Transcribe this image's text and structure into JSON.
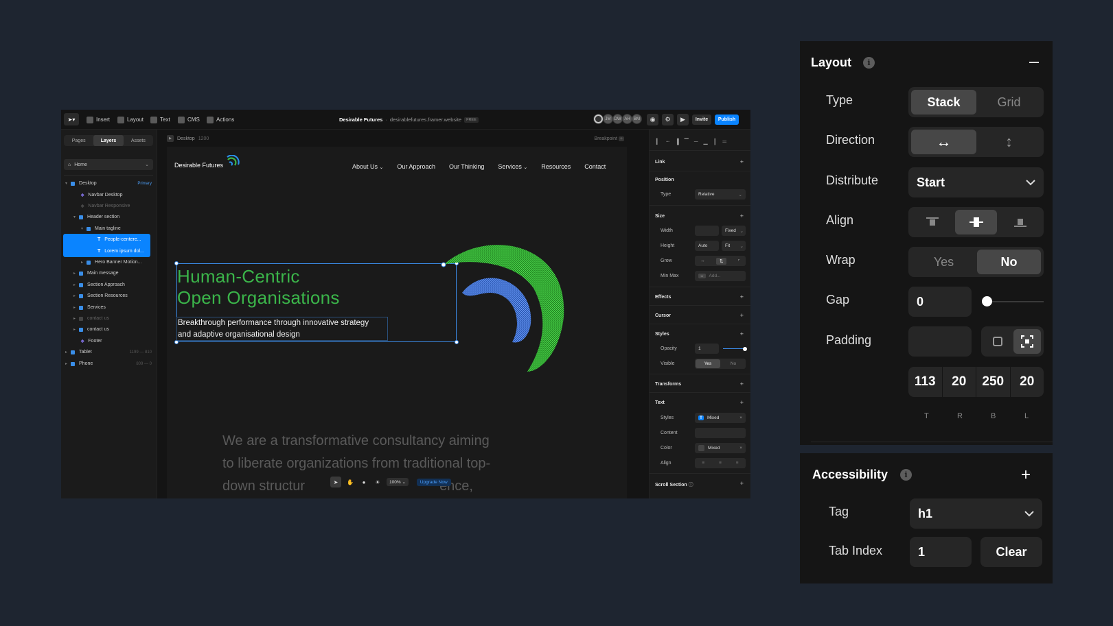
{
  "app": {
    "toolbar": {
      "insert": "Insert",
      "layout": "Layout",
      "text": "Text",
      "cms": "CMS",
      "actions": "Actions",
      "project_title": "Desirable Futures",
      "project_url": "desirablefutures.framer.website",
      "plan_badge": "FREE",
      "avatars": [
        "JM",
        "DW",
        "AH",
        "BM"
      ],
      "invite": "Invite",
      "publish": "Publish"
    },
    "left_panel": {
      "tabs": [
        "Pages",
        "Layers",
        "Assets"
      ],
      "active_tab": "Layers",
      "page_select": "Home",
      "layers": [
        {
          "label": "Desktop",
          "tag": "Primary"
        },
        {
          "label": "Navbar Desktop"
        },
        {
          "label": "Navbar Responsive"
        },
        {
          "label": "Header section"
        },
        {
          "label": "Main tagline"
        },
        {
          "label": "People-centere..."
        },
        {
          "label": "Lorem ipsum dol..."
        },
        {
          "label": "Hero Banner Motion..."
        },
        {
          "label": "Main message"
        },
        {
          "label": "Section Approach"
        },
        {
          "label": "Section Resources"
        },
        {
          "label": "Services"
        },
        {
          "label": "contact us"
        },
        {
          "label": "contact us"
        },
        {
          "label": "Footer"
        },
        {
          "label": "Tablet",
          "tag": "1199 — 810"
        },
        {
          "label": "Phone",
          "tag": "809 — 0"
        }
      ]
    },
    "canvas": {
      "breakpoint_label": "Desktop",
      "breakpoint_width": "1200",
      "breakpoint_button": "Breakpoint",
      "site": {
        "logo": "Desirable Futures",
        "nav": [
          "About Us",
          "Our Approach",
          "Our Thinking",
          "Services",
          "Resources",
          "Contact"
        ],
        "headline_line1": "Human-Centric",
        "headline_line2": "Open Organisations",
        "subline_line1": "Breakthrough performance through innovative strategy",
        "subline_line2": "and adaptive organisational design",
        "message_line1": "We are a transformative consultancy aiming",
        "message_line2": "to liberate organizations from traditional top-",
        "message_line3_a": "down structur",
        "message_line3_b": "ence,"
      },
      "bottom_toolbar": {
        "zoom": "100%",
        "upgrade": "Upgrade Now"
      }
    },
    "right_panel": {
      "link": "Link",
      "position": "Position",
      "type_label": "Type",
      "type_value": "Relative",
      "size": "Size",
      "width_label": "Width",
      "width_mode": "Fixed",
      "height_label": "Height",
      "height_value": "Auto",
      "height_mode": "Fit",
      "grow_label": "Grow",
      "minmax_label": "Min Max",
      "minmax_value": "Add...",
      "effects": "Effects",
      "cursor": "Cursor",
      "styles": "Styles",
      "opacity_label": "Opacity",
      "opacity_value": "1",
      "visible_label": "Visible",
      "visible_yes": "Yes",
      "visible_no": "No",
      "transforms": "Transforms",
      "text": "Text",
      "text_styles_label": "Styles",
      "text_styles_value": "Mixed",
      "content_label": "Content",
      "color_label": "Color",
      "color_value": "Mixed",
      "align_label": "Align",
      "scroll_section": "Scroll Section"
    }
  },
  "layout_panel": {
    "title": "Layout",
    "type_label": "Type",
    "type_options": [
      "Stack",
      "Grid"
    ],
    "type_selected": "Stack",
    "direction_label": "Direction",
    "distribute_label": "Distribute",
    "distribute_value": "Start",
    "align_label": "Align",
    "wrap_label": "Wrap",
    "wrap_options": [
      "Yes",
      "No"
    ],
    "wrap_selected": "No",
    "gap_label": "Gap",
    "gap_value": "0",
    "gap_slider_fraction": 0,
    "padding_label": "Padding",
    "padding_values": [
      "113",
      "20",
      "250",
      "20"
    ],
    "padding_sides": [
      "T",
      "R",
      "B",
      "L"
    ]
  },
  "accessibility_panel": {
    "title": "Accessibility",
    "tag_label": "Tag",
    "tag_value": "h1",
    "tab_index_label": "Tab Index",
    "tab_index_value": "1",
    "clear_button": "Clear"
  },
  "colors": {
    "background": "#1e2530",
    "accent_blue": "#0a84ff",
    "headline_green": "#3bb54a",
    "ring_green": "#2fb52f",
    "ring_blue": "#3a78e6"
  }
}
